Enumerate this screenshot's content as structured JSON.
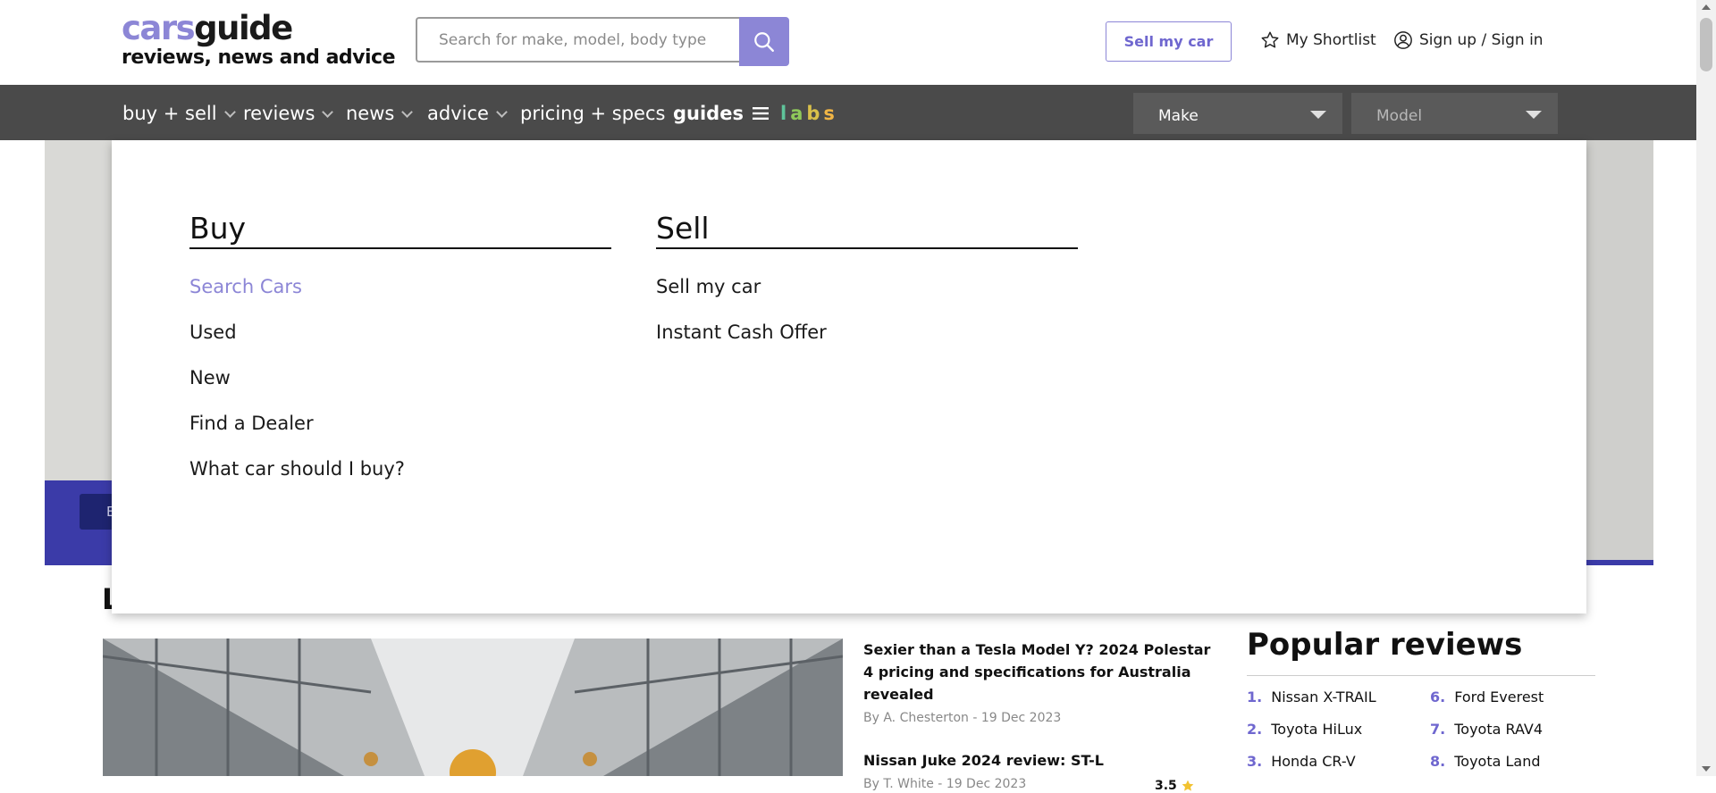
{
  "header": {
    "logo": {
      "cars": "cars",
      "guide": "guide",
      "tagline": "reviews, news and advice"
    },
    "search": {
      "placeholder": "Search for make, model, body type",
      "value": ""
    },
    "sell_button": "Sell my car",
    "shortlist_label": "My Shortlist",
    "signin_label": "Sign up / Sign in"
  },
  "nav": {
    "items": [
      "buy + sell",
      "reviews",
      "news",
      "advice",
      "pricing + specs",
      "guides"
    ],
    "labs": [
      "l",
      "a",
      "b",
      "s"
    ],
    "make_select": "Make",
    "model_select": "Model"
  },
  "dropdown": {
    "buy": {
      "heading": "Buy",
      "links": [
        "Search Cars",
        "Used",
        "New",
        "Find a Dealer",
        "What car should I buy?"
      ]
    },
    "sell": {
      "heading": "Sell",
      "links": [
        "Sell my car",
        "Instant Cash Offer"
      ]
    }
  },
  "background": {
    "partial_letter": "L",
    "partial_button_letter": "E"
  },
  "articles": [
    {
      "title": "Sexier than a Tesla Model Y? 2024 Polestar 4 pricing and specifications for Australia revealed",
      "meta": "By A. Chesterton - 19 Dec 2023"
    },
    {
      "title": "Nissan Juke 2024 review: ST-L",
      "meta": "By T. White - 19 Dec 2023",
      "rating": "3.5"
    }
  ],
  "popular_reviews": {
    "heading": "Popular reviews",
    "items": [
      {
        "num": "1.",
        "name": "Nissan X-TRAIL"
      },
      {
        "num": "2.",
        "name": "Toyota HiLux"
      },
      {
        "num": "3.",
        "name": "Honda CR-V"
      },
      {
        "num": "6.",
        "name": "Ford Everest"
      },
      {
        "num": "7.",
        "name": "Toyota RAV4"
      },
      {
        "num": "8.",
        "name": "Toyota Land"
      }
    ]
  },
  "colors": {
    "accent": "#8c86d6",
    "nav_bg": "#4a4a4a",
    "text": "#1a1a1a"
  },
  "icons": [
    "search-icon",
    "star-icon",
    "user-circle-icon",
    "chevron-down-icon",
    "hamburger-icon",
    "caret-down-icon",
    "rating-star-icon"
  ]
}
